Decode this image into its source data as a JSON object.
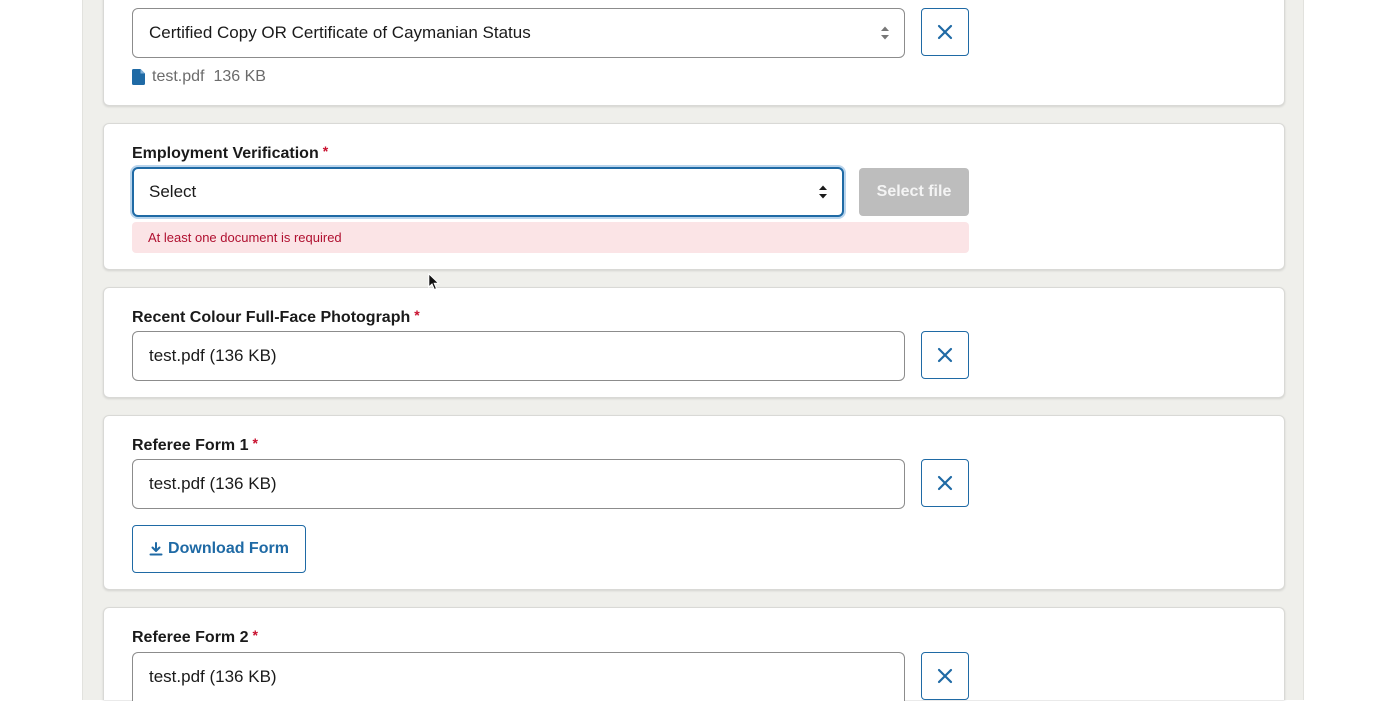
{
  "sections": {
    "status_doc": {
      "selected_value": "Certified Copy OR Certificate of Caymanian Status",
      "attached_file_name": "test.pdf",
      "attached_file_size": "136 KB"
    },
    "employment": {
      "label": "Employment Verification",
      "required_mark": "*",
      "selected_value": "Select",
      "select_file_label": "Select file",
      "error_text": "At least one document is required"
    },
    "photo": {
      "label": "Recent Colour Full-Face Photograph",
      "required_mark": "*",
      "value": "test.pdf (136 KB)"
    },
    "referee1": {
      "label": "Referee Form 1",
      "required_mark": "*",
      "value": "test.pdf (136 KB)",
      "download_label": "Download Form"
    },
    "referee2": {
      "label": "Referee Form 2",
      "required_mark": "*",
      "value": "test.pdf (136 KB)"
    }
  },
  "colors": {
    "accent": "#1f6aa5",
    "required": "#c8102e",
    "error_bg": "#fbe4e6",
    "error_text": "#b01030",
    "disabled_button": "#bdbdbd"
  },
  "icons": {
    "remove": "close-icon",
    "select": "select-arrows-icon",
    "file": "document-icon",
    "download": "download-icon",
    "cursor": "mouse-cursor-icon"
  }
}
